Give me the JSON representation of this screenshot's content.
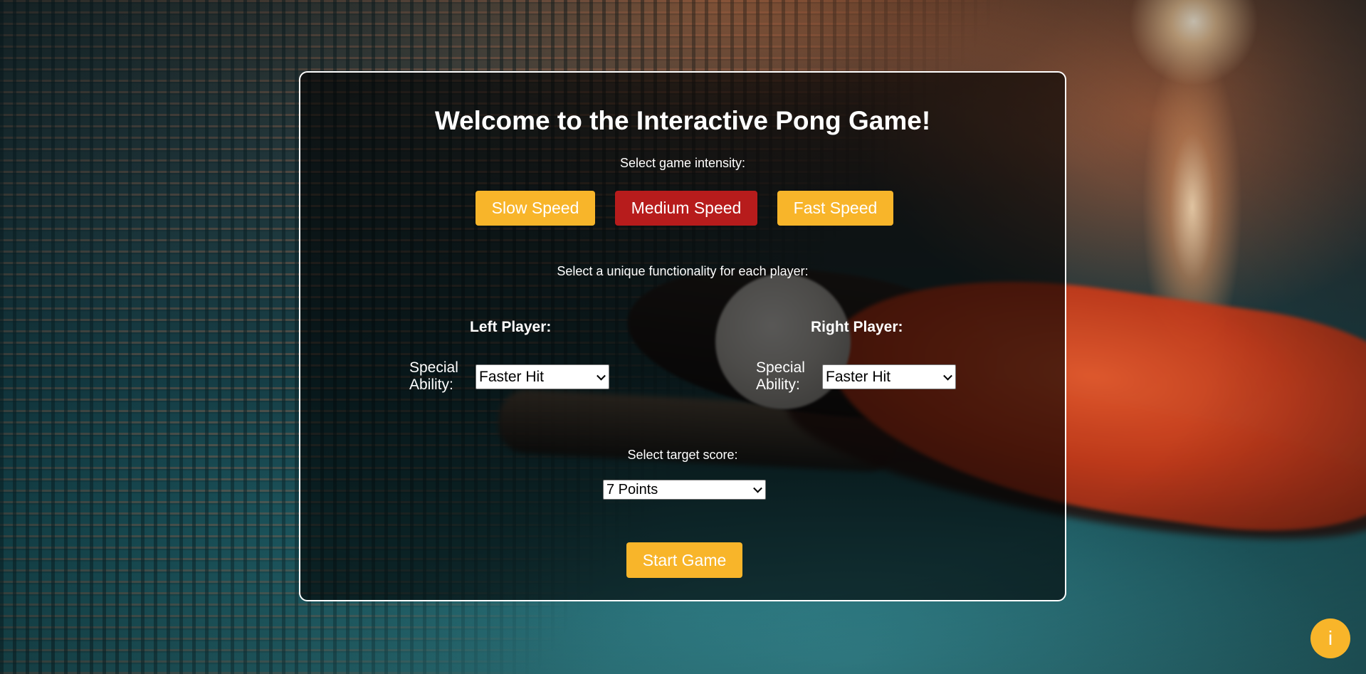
{
  "colors": {
    "accent_yellow": "#f8b52a",
    "selected_red": "#b71c1c",
    "panel_border": "#ffffff",
    "text": "#ffffff"
  },
  "main": {
    "title": "Welcome to the Interactive Pong Game!",
    "intensity": {
      "label": "Select game intensity:",
      "buttons": [
        {
          "label": "Slow Speed",
          "selected": false
        },
        {
          "label": "Medium Speed",
          "selected": true
        },
        {
          "label": "Fast Speed",
          "selected": false
        }
      ]
    },
    "functionality_label": "Select a unique functionality for each player:",
    "left_player": {
      "heading": "Left Player:",
      "ability_label": "Special Ability:",
      "ability_value": "Faster Hit"
    },
    "right_player": {
      "heading": "Right Player:",
      "ability_label": "Special Ability:",
      "ability_value": "Faster Hit"
    },
    "target": {
      "label": "Select target score:",
      "value": "7 Points"
    },
    "start_label": "Start Game"
  },
  "info_button": {
    "label": "i",
    "icon": "info-icon"
  }
}
